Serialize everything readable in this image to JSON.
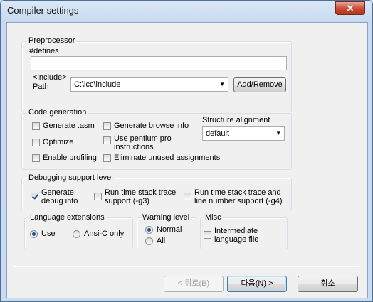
{
  "window": {
    "title": "Compiler settings",
    "close_glyph": "✕"
  },
  "preprocessor": {
    "group_label": "Preprocessor",
    "defines_label": "#defines",
    "defines_value": "",
    "include_label_line1": "<include>",
    "include_label_line2": "Path",
    "include_path_value": "C:\\lcc\\include",
    "add_remove_label": "Add/Remove"
  },
  "code_generation": {
    "group_label": "Code generation",
    "generate_asm": {
      "label": "Generate .asm",
      "checked": false
    },
    "optimize": {
      "label": "Optimize",
      "checked": false
    },
    "enable_profiling": {
      "label": "Enable profiling",
      "checked": false
    },
    "generate_browse": {
      "label": "Generate browse info",
      "checked": false
    },
    "use_pentium_line1": "Use pentium pro",
    "use_pentium_line2": "instructions",
    "use_pentium_checked": false,
    "eliminate_unused": {
      "label": "Eliminate unused assignments",
      "checked": false
    },
    "structure_alignment_label": "Structure alignment",
    "structure_alignment_value": "default"
  },
  "debugging": {
    "group_label": "Debugging support level",
    "debug_info_line1": "Generate",
    "debug_info_line2": "debug info",
    "debug_info_checked": true,
    "stack_trace_line1": "Run time stack trace",
    "stack_trace_line2": "support (-g3)",
    "stack_trace_checked": false,
    "stack_trace_line_line1": "Run time stack trace and",
    "stack_trace_line_line2": "line number support (-g4)",
    "stack_trace_line_checked": false
  },
  "language_extensions": {
    "group_label": "Language extensions",
    "use_label": "Use",
    "ansi_label": "Ansi-C only",
    "selected": "Use"
  },
  "warning_level": {
    "group_label": "Warning level",
    "normal_label": "Normal",
    "all_label": "All",
    "selected": "Normal"
  },
  "misc": {
    "group_label": "Misc",
    "intermediate_line1": "Intermediate",
    "intermediate_line2": "language file",
    "intermediate_checked": false
  },
  "buttons": {
    "back_label": "< 뒤로(B)",
    "next_label": "다음(N) >",
    "cancel_label": "취소"
  }
}
